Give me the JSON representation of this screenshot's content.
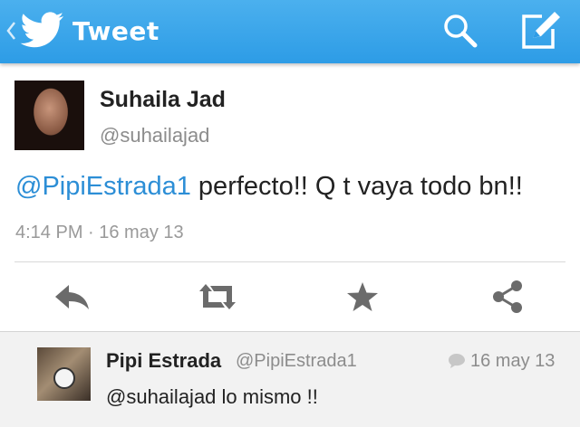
{
  "actionbar": {
    "title": "Tweet",
    "icons": [
      "chevron-left-icon",
      "twitter-bird-icon",
      "search-icon",
      "compose-icon"
    ],
    "colors": {
      "bar": "#2d9ce6",
      "text": "#ffffff"
    }
  },
  "tweet": {
    "author_name": "Suhaila Jad",
    "author_handle": "@suhailajad",
    "mention": "@PipiEstrada1",
    "body": " perfecto!! Q t vaya todo bn!!",
    "timestamp": "4:14 PM · 16 may 13",
    "colors": {
      "mention": "#2c8ed6",
      "meta": "#999999"
    }
  },
  "actions": {
    "icons": [
      "reply-icon",
      "retweet-icon",
      "favorite-star-icon",
      "share-icon"
    ],
    "color": "#6b6b6b"
  },
  "reply": {
    "author_name": "Pipi Estrada",
    "author_handle": "@PipiEstrada1",
    "date": "16 may 13",
    "text": "@suhailajad lo mismo !!",
    "icon": "conversation-bubble-icon"
  }
}
